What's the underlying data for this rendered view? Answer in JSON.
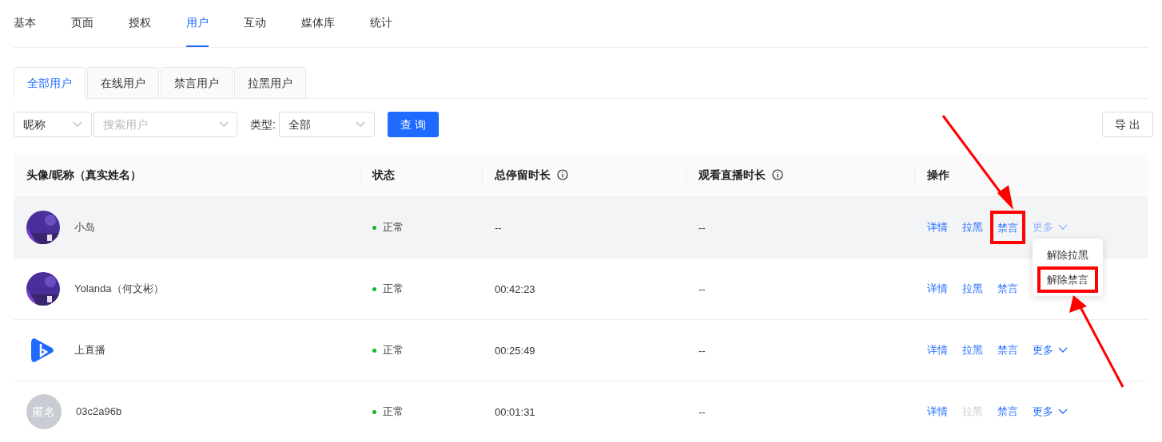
{
  "nav_tabs": [
    {
      "label": "基本",
      "selected": false
    },
    {
      "label": "页面",
      "selected": false
    },
    {
      "label": "授权",
      "selected": false
    },
    {
      "label": "用户",
      "selected": true
    },
    {
      "label": "互动",
      "selected": false
    },
    {
      "label": "媒体库",
      "selected": false
    },
    {
      "label": "统计",
      "selected": false
    }
  ],
  "sub_tabs": [
    {
      "label": "全部用户",
      "selected": true
    },
    {
      "label": "在线用户",
      "selected": false
    },
    {
      "label": "禁言用户",
      "selected": false
    },
    {
      "label": "拉黑用户",
      "selected": false
    }
  ],
  "filters": {
    "field_select": "昵称",
    "search_placeholder": "搜索用户",
    "type_label": "类型:",
    "type_select": "全部",
    "query_button": "查 询"
  },
  "export_button": "导 出",
  "table": {
    "columns": [
      {
        "label": "头像/昵称（真实姓名）",
        "info": false
      },
      {
        "label": "状态",
        "info": false
      },
      {
        "label": "总停留时长",
        "info": true
      },
      {
        "label": "观看直播时长",
        "info": true
      },
      {
        "label": "操作",
        "info": false
      }
    ],
    "rows": [
      {
        "avatar": {
          "kind": "picture"
        },
        "name": "小岛",
        "status": "正常",
        "stay": "--",
        "watch": "--",
        "hovered": true,
        "actions": [
          {
            "label": "详情",
            "disabled": false
          },
          {
            "label": "拉黑",
            "disabled": false
          },
          {
            "label": "禁言",
            "disabled": false
          }
        ],
        "more": {
          "label": "更多",
          "open": true,
          "menu": [
            "解除拉黑",
            "解除禁言"
          ]
        }
      },
      {
        "avatar": {
          "kind": "picture"
        },
        "name": "Yolanda（何文彬）",
        "status": "正常",
        "stay": "00:42:23",
        "watch": "--",
        "hovered": false,
        "actions": [
          {
            "label": "详情",
            "disabled": false
          },
          {
            "label": "拉黑",
            "disabled": false
          },
          {
            "label": "禁言",
            "disabled": false
          }
        ]
      },
      {
        "avatar": {
          "kind": "logo"
        },
        "name": "上直播",
        "status": "正常",
        "stay": "00:25:49",
        "watch": "--",
        "hovered": false,
        "actions": [
          {
            "label": "详情",
            "disabled": false
          },
          {
            "label": "拉黑",
            "disabled": false
          },
          {
            "label": "禁言",
            "disabled": false
          }
        ],
        "more": {
          "label": "更多",
          "open": false
        }
      },
      {
        "avatar": {
          "kind": "text",
          "text": "匿名"
        },
        "name": "03c2a96b",
        "status": "正常",
        "stay": "00:01:31",
        "watch": "--",
        "hovered": false,
        "actions": [
          {
            "label": "详情",
            "disabled": false
          },
          {
            "label": "拉黑",
            "disabled": true
          },
          {
            "label": "禁言",
            "disabled": false
          }
        ],
        "more": {
          "label": "更多",
          "open": false
        }
      }
    ]
  }
}
